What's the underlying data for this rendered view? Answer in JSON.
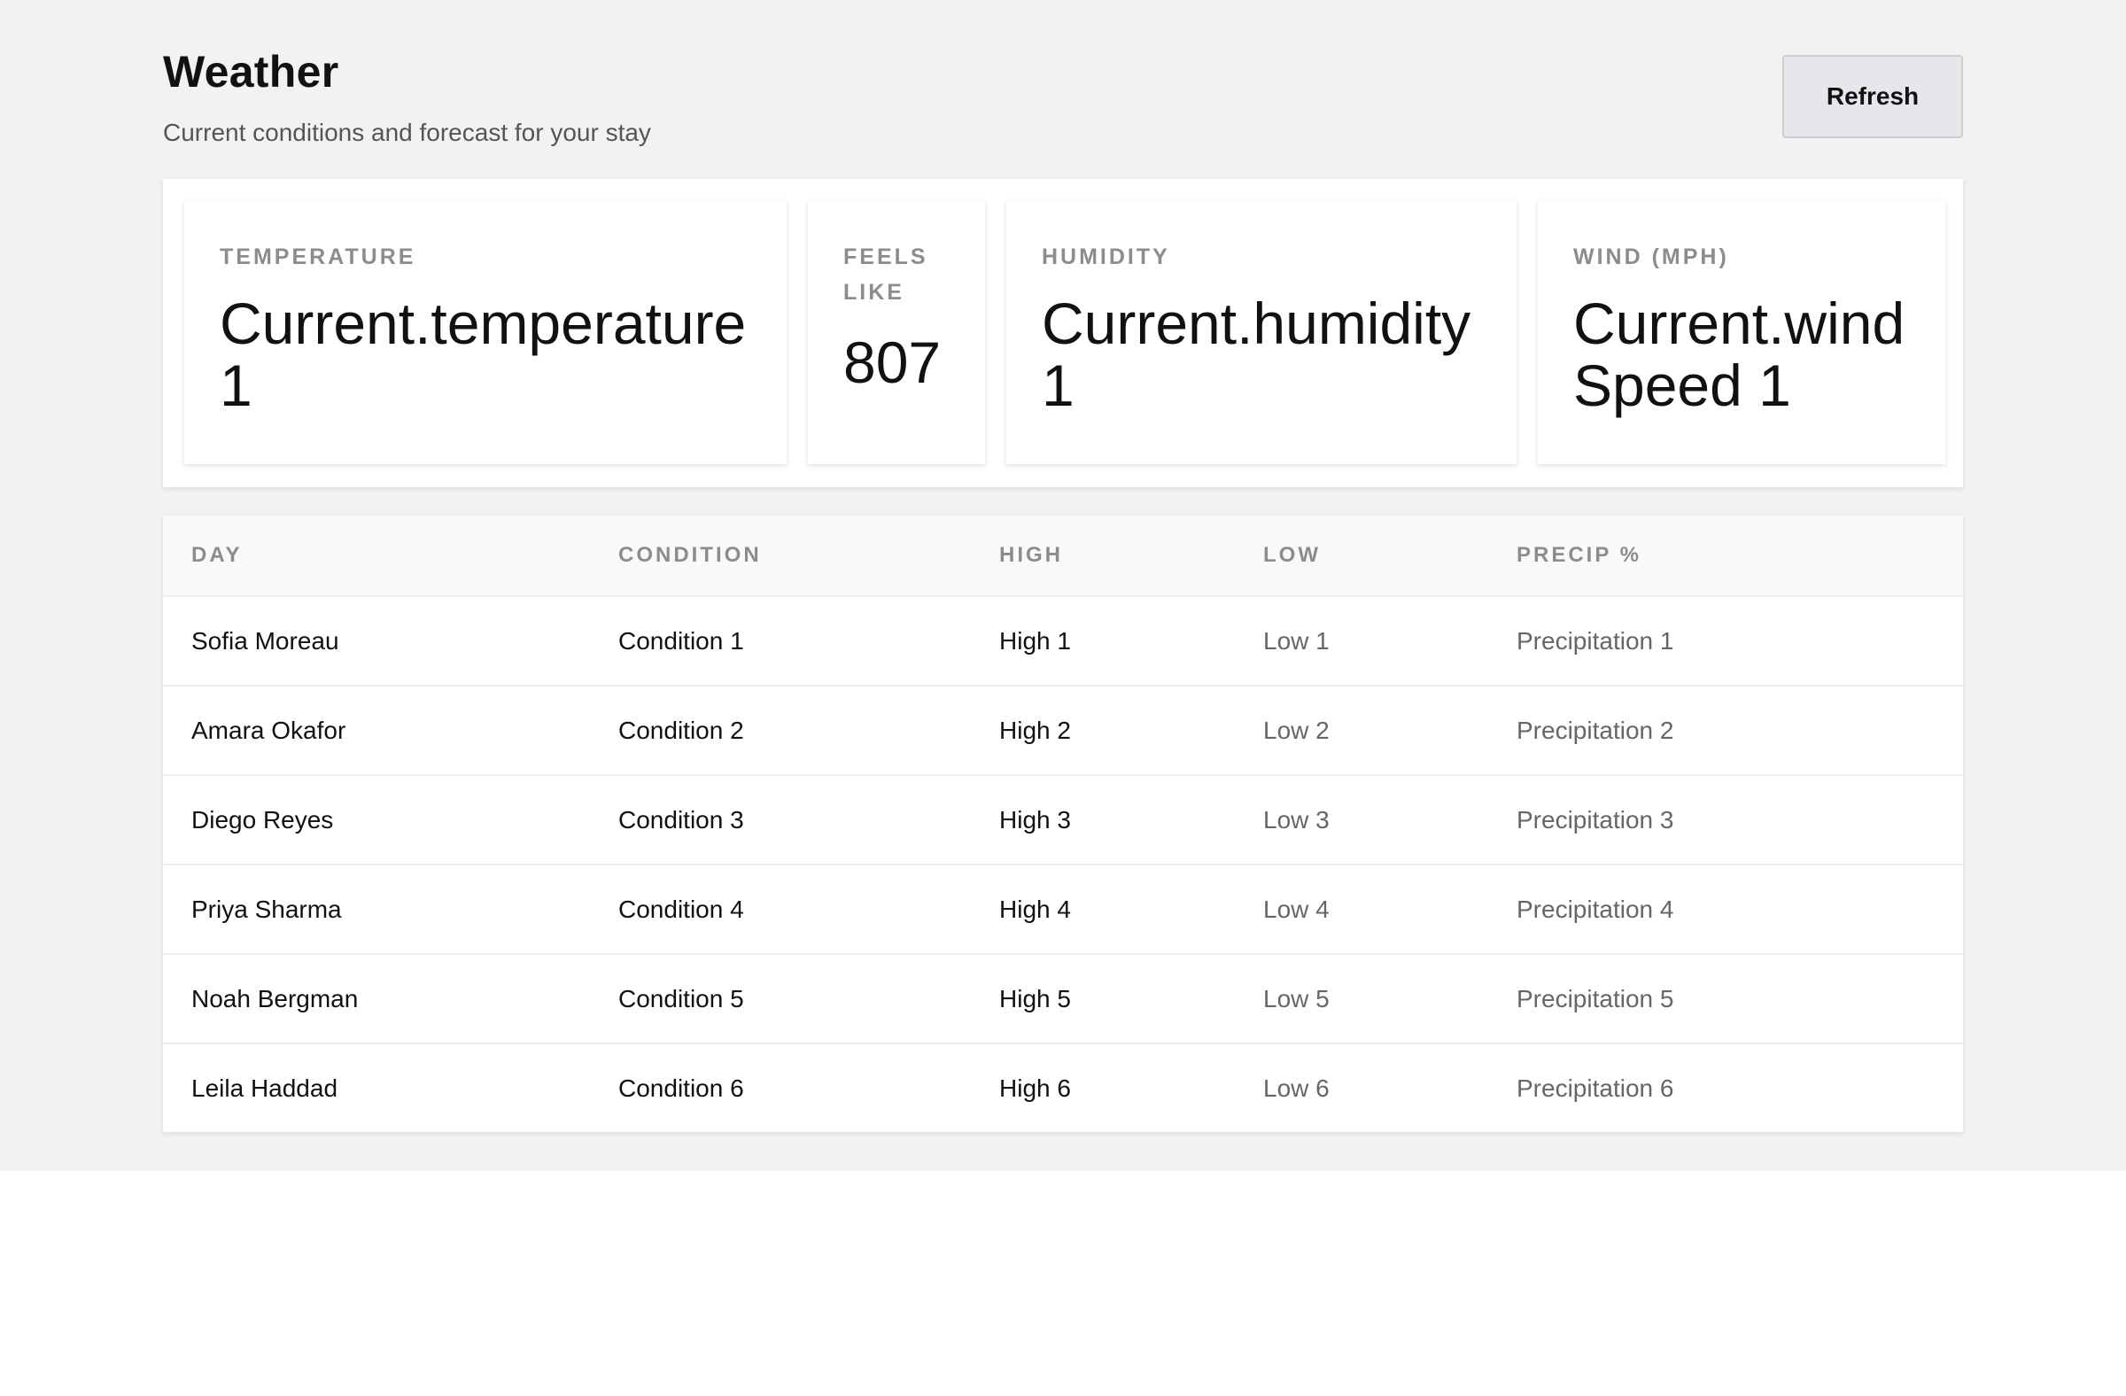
{
  "header": {
    "title": "Weather",
    "subtitle": "Current conditions and forecast for your stay",
    "refresh_label": "Refresh"
  },
  "stats": {
    "temperature": {
      "label": "Temperature",
      "value": "Current.temperature 1"
    },
    "feels_like": {
      "label": "Feels like",
      "value": "807"
    },
    "humidity": {
      "label": "Humidity",
      "value": "Current.humidity 1"
    },
    "wind": {
      "label": "Wind (mph)",
      "value": "Current.wind Speed 1"
    }
  },
  "table": {
    "columns": [
      "Day",
      "Condition",
      "High",
      "Low",
      "Precip %"
    ],
    "rows": [
      {
        "day": "Sofia Moreau",
        "condition": "Condition 1",
        "high": "High 1",
        "low": "Low 1",
        "precip": "Precipitation 1"
      },
      {
        "day": "Amara Okafor",
        "condition": "Condition 2",
        "high": "High 2",
        "low": "Low 2",
        "precip": "Precipitation 2"
      },
      {
        "day": "Diego Reyes",
        "condition": "Condition 3",
        "high": "High 3",
        "low": "Low 3",
        "precip": "Precipitation 3"
      },
      {
        "day": "Priya Sharma",
        "condition": "Condition 4",
        "high": "High 4",
        "low": "Low 4",
        "precip": "Precipitation 4"
      },
      {
        "day": "Noah Bergman",
        "condition": "Condition 5",
        "high": "High 5",
        "low": "Low 5",
        "precip": "Precipitation 5"
      },
      {
        "day": "Leila Haddad",
        "condition": "Condition 6",
        "high": "High 6",
        "low": "Low 6",
        "precip": "Precipitation 6"
      }
    ]
  }
}
